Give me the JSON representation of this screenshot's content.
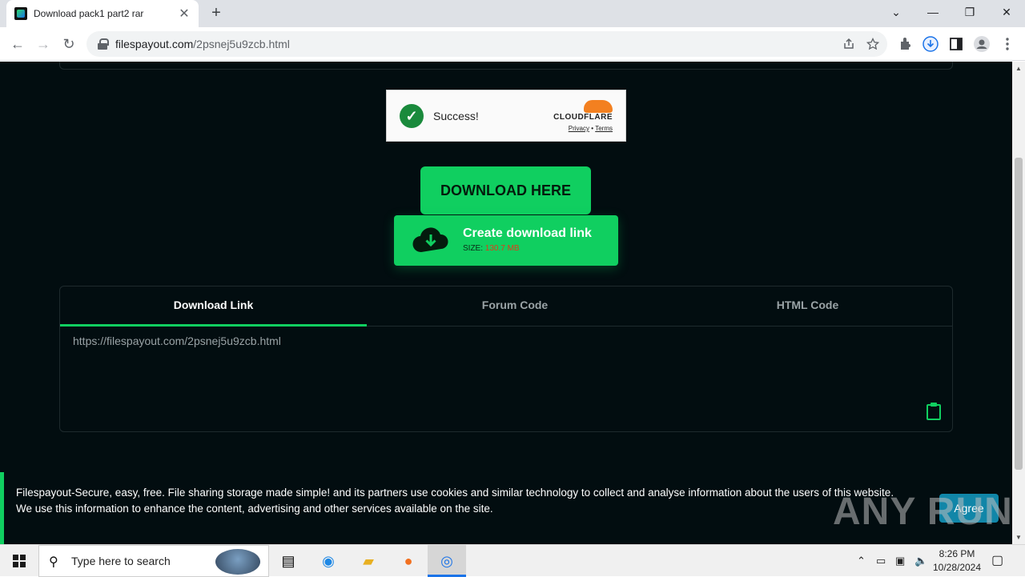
{
  "browser": {
    "tab_title": "Download pack1 part2 rar",
    "tab_close": "✕",
    "new_tab": "+",
    "url_host": "filespayout.com",
    "url_path": "/2psnej5u9zcb.html",
    "window_controls": {
      "dropdown": "⌄",
      "minimize": "—",
      "restore": "❐",
      "close": "✕"
    },
    "nav": {
      "back": "←",
      "forward": "→",
      "reload": "↻"
    },
    "icons": [
      "share-icon",
      "star-icon",
      "extensions-icon",
      "download-icon",
      "sidepanel-icon",
      "profile-icon",
      "menu-icon"
    ]
  },
  "captcha": {
    "status": "Success!",
    "brand": "CLOUDFLARE",
    "privacy": "Privacy",
    "separator": " • ",
    "terms": "Terms"
  },
  "download": {
    "button_label": "DOWNLOAD HERE",
    "create_label": "Create download link",
    "size_label": "SIZE: ",
    "size_value": "130.7 MB"
  },
  "panel": {
    "tabs": [
      "Download Link",
      "Forum Code",
      "HTML Code"
    ],
    "active_tab": 0,
    "link": "https://filespayout.com/2psnej5u9zcb.html"
  },
  "cookie": {
    "line1": "Filespayout-Secure, easy, free. File sharing storage made simple! and its partners use cookies and similar technology to collect and analyse information about the users of this website.",
    "line2": "We use this information to enhance the content, advertising and other services available on the site.",
    "agree": "Agree"
  },
  "watermark": "ANY RUN",
  "taskbar": {
    "search_placeholder": "Type here to search",
    "time": "8:26 PM",
    "date": "10/28/2024"
  },
  "colors": {
    "accent": "#10cf60",
    "page_bg": "#020d10",
    "size_value": "#e03a1a",
    "agree": "#1186a8"
  }
}
